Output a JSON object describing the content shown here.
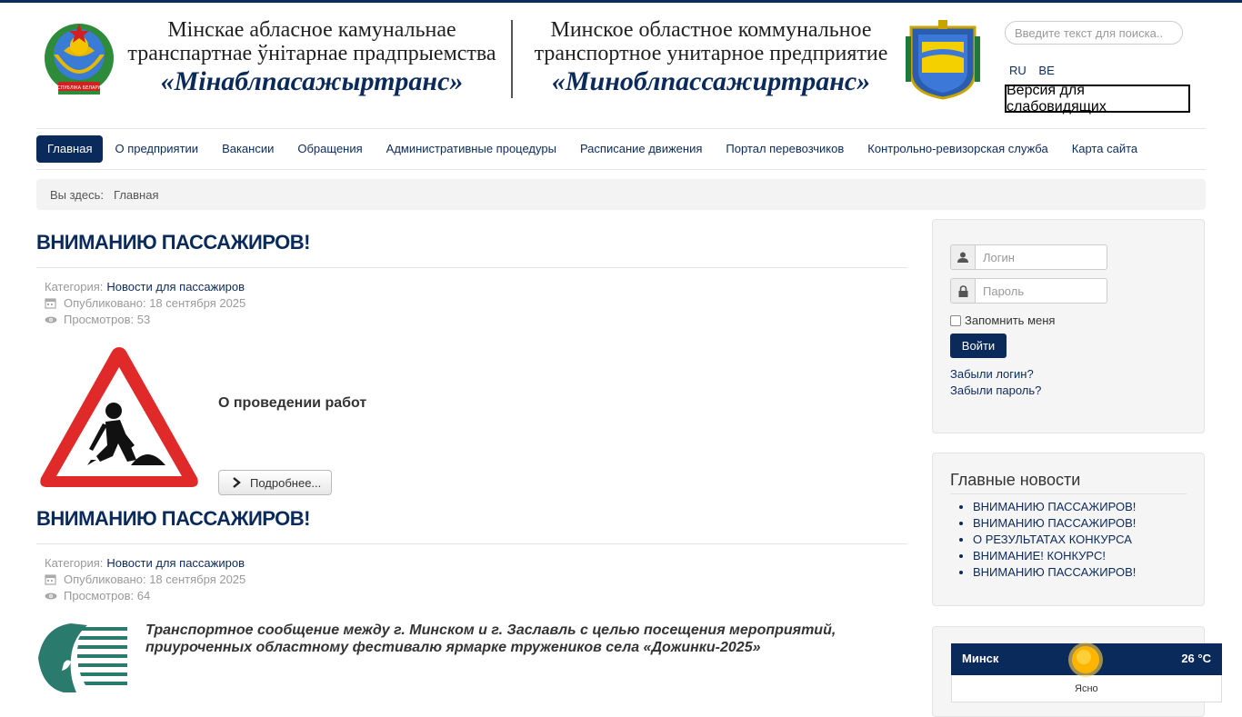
{
  "header": {
    "org_be_line1": "Мінскае абласное камунальнае",
    "org_be_line2": "транспартнае ўнітарнае прадпрыемства",
    "org_be_name": "«Мінаблпасажыртранс»",
    "org_ru_line1": "Минское областное коммунальное",
    "org_ru_line2": "транспортное унитарное предприятие",
    "org_ru_name": "«Миноблпассажиртранс»",
    "emblem_by_text": "РЭСПУБЛІКА БЕЛАРУСЬ",
    "search_placeholder": "Введите текст для поиска..",
    "lang_ru": "RU",
    "lang_be": "BE",
    "low_vision": "Версия для слабовидящих"
  },
  "nav": {
    "items": [
      "Главная",
      "О предприятии",
      "Вакансии",
      "Обращения",
      "Административные процедуры",
      "Расписание движения",
      "Портал перевозчиков",
      "Контрольно-ревизорская служба",
      "Карта сайта"
    ]
  },
  "breadcrumb": {
    "prefix": "Вы здесь:",
    "current": "Главная"
  },
  "articles": [
    {
      "title": "ВНИМАНИЮ ПАССАЖИРОВ!",
      "category_label": "Категория:",
      "category": "Новости для пассажиров",
      "published": "Опубликовано: 18 сентября 2025",
      "views": "Просмотров: 53",
      "text": "О проведении работ",
      "read_more": "Подробнее..."
    },
    {
      "title": "ВНИМАНИЮ ПАССАЖИРОВ!",
      "category_label": "Категория:",
      "category": "Новости для пассажиров",
      "published": "Опубликовано: 18 сентября 2025",
      "views": "Просмотров: 64",
      "text": "Транспортное сообщение между г. Минском и г. Заславль с целью посещения мероприятий, приуроченных областному фестивалю ярмарке тружеников села «Дожинки-2025»"
    }
  ],
  "login": {
    "login_placeholder": "Логин",
    "password_placeholder": "Пароль",
    "remember": "Запомнить меня",
    "submit": "Войти",
    "forgot_login": "Забыли логин?",
    "forgot_password": "Забыли пароль?"
  },
  "news": {
    "title": "Главные новости",
    "items": [
      "ВНИМАНИЮ ПАССАЖИРОВ!",
      "ВНИМАНИЮ ПАССАЖИРОВ!",
      "О РЕЗУЛЬТАТАХ КОНКУРСА",
      "ВНИМАНИЕ! КОНКУРС!",
      "ВНИМАНИЮ ПАССАЖИРОВ!"
    ]
  },
  "weather": {
    "city": "Минск",
    "temp": "26 °C",
    "condition": "Ясно"
  },
  "colors": {
    "brand": "#0b2a5c",
    "warning_red": "#e02a2a"
  }
}
